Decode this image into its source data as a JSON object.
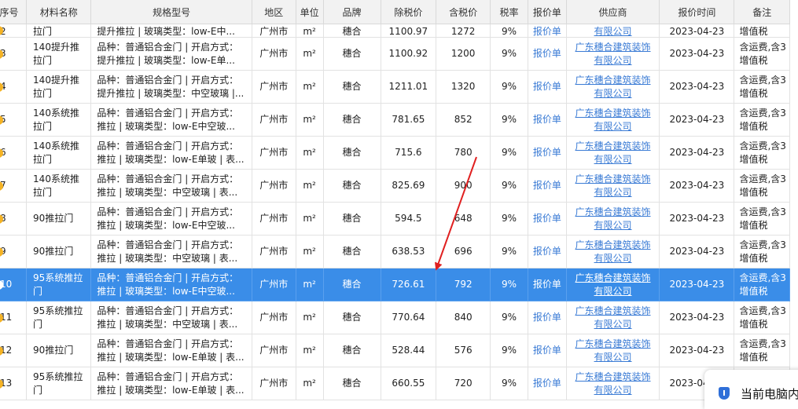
{
  "columns": [
    "序号",
    "材料名称",
    "规格型号",
    "地区",
    "单位",
    "品牌",
    "除税价",
    "含税价",
    "税率",
    "报价单",
    "供应商",
    "报价时间",
    "备注"
  ],
  "partial_row": {
    "index": "2",
    "name": "拉门",
    "spec": "提升推拉 | 玻璃类型：low-E中...",
    "region": "广州市",
    "unit": "m²",
    "brand": "穗合",
    "price_ex": "1100.97",
    "price_inc": "1272",
    "tax": "9%",
    "quote": "报价单",
    "supplier": "有限公司",
    "time": "2023-04-23",
    "remark": "增值税"
  },
  "rows": [
    {
      "index": "3",
      "name": [
        "140提升推",
        "拉门"
      ],
      "spec": [
        "品种：普通铝合金门 | 开启方式：",
        "提升推拉 | 玻璃类型：low-E单..."
      ],
      "region": "广州市",
      "unit": "m²",
      "brand": "穗合",
      "price_ex": "1100.92",
      "price_inc": "1200",
      "tax": "9%",
      "quote": "报价单",
      "supplier": [
        "广东穗合建筑装饰",
        "有限公司"
      ],
      "time": "2023-04-23",
      "remark": [
        "含运费,含3",
        "增值税"
      ]
    },
    {
      "index": "4",
      "name": [
        "140提升推",
        "拉门"
      ],
      "spec": [
        "品种：普通铝合金门 | 开启方式：",
        "提升推拉 | 玻璃类型：中空玻璃 |..."
      ],
      "region": "广州市",
      "unit": "m²",
      "brand": "穗合",
      "price_ex": "1211.01",
      "price_inc": "1320",
      "tax": "9%",
      "quote": "报价单",
      "supplier": [
        "广东穗合建筑装饰",
        "有限公司"
      ],
      "time": "2023-04-23",
      "remark": [
        "含运费,含3",
        "增值税"
      ]
    },
    {
      "index": "5",
      "name": [
        "140系统推",
        "拉门"
      ],
      "spec": [
        "品种：普通铝合金门 | 开启方式：",
        "推拉 | 玻璃类型：low-E中空玻..."
      ],
      "region": "广州市",
      "unit": "m²",
      "brand": "穗合",
      "price_ex": "781.65",
      "price_inc": "852",
      "tax": "9%",
      "quote": "报价单",
      "supplier": [
        "广东穗合建筑装饰",
        "有限公司"
      ],
      "time": "2023-04-23",
      "remark": [
        "含运费,含3",
        "增值税"
      ]
    },
    {
      "index": "6",
      "name": [
        "140系统推",
        "拉门"
      ],
      "spec": [
        "品种：普通铝合金门 | 开启方式：",
        "推拉 | 玻璃类型：low-E单玻 | 表..."
      ],
      "region": "广州市",
      "unit": "m²",
      "brand": "穗合",
      "price_ex": "715.6",
      "price_inc": "780",
      "tax": "9%",
      "quote": "报价单",
      "supplier": [
        "广东穗合建筑装饰",
        "有限公司"
      ],
      "time": "2023-04-23",
      "remark": [
        "含运费,含3",
        "增值税"
      ]
    },
    {
      "index": "7",
      "name": [
        "140系统推",
        "拉门"
      ],
      "spec": [
        "品种：普通铝合金门 | 开启方式：",
        "推拉 | 玻璃类型：中空玻璃 | 表..."
      ],
      "region": "广州市",
      "unit": "m²",
      "brand": "穗合",
      "price_ex": "825.69",
      "price_inc": "900",
      "tax": "9%",
      "quote": "报价单",
      "supplier": [
        "广东穗合建筑装饰",
        "有限公司"
      ],
      "time": "2023-04-23",
      "remark": [
        "含运费,含3",
        "增值税"
      ]
    },
    {
      "index": "8",
      "name": [
        "90推拉门"
      ],
      "spec": [
        "品种：普通铝合金门 | 开启方式：",
        "推拉 | 玻璃类型：low-E中空玻..."
      ],
      "region": "广州市",
      "unit": "m²",
      "brand": "穗合",
      "price_ex": "594.5",
      "price_inc": "648",
      "tax": "9%",
      "quote": "报价单",
      "supplier": [
        "广东穗合建筑装饰",
        "有限公司"
      ],
      "time": "2023-04-23",
      "remark": [
        "含运费,含3",
        "增值税"
      ]
    },
    {
      "index": "9",
      "name": [
        "90推拉门"
      ],
      "spec": [
        "品种：普通铝合金门 | 开启方式：",
        "推拉 | 玻璃类型：中空玻璃 | 表..."
      ],
      "region": "广州市",
      "unit": "m²",
      "brand": "穗合",
      "price_ex": "638.53",
      "price_inc": "696",
      "tax": "9%",
      "quote": "报价单",
      "supplier": [
        "广东穗合建筑装饰",
        "有限公司"
      ],
      "time": "2023-04-23",
      "remark": [
        "含运费,含3",
        "增值税"
      ]
    },
    {
      "index": "10",
      "selected": true,
      "name": [
        "95系统推拉",
        "门"
      ],
      "spec": [
        "品种：普通铝合金门 | 开启方式：",
        "推拉 | 玻璃类型：low-E中空玻..."
      ],
      "region": "广州市",
      "unit": "m²",
      "brand": "穗合",
      "price_ex": "726.61",
      "price_inc": "792",
      "tax": "9%",
      "quote": "报价单",
      "supplier": [
        "广东穗合建筑装饰",
        "有限公司"
      ],
      "time": "2023-04-23",
      "remark": [
        "含运费,含3",
        "增值税"
      ]
    },
    {
      "index": "11",
      "name": [
        "95系统推拉",
        "门"
      ],
      "spec": [
        "品种：普通铝合金门 | 开启方式：",
        "推拉 | 玻璃类型：中空玻璃 | 表..."
      ],
      "region": "广州市",
      "unit": "m²",
      "brand": "穗合",
      "price_ex": "770.64",
      "price_inc": "840",
      "tax": "9%",
      "quote": "报价单",
      "supplier": [
        "广东穗合建筑装饰",
        "有限公司"
      ],
      "time": "2023-04-23",
      "remark": [
        "含运费,含3",
        "增值税"
      ]
    },
    {
      "index": "12",
      "name": [
        "90推拉门"
      ],
      "spec": [
        "品种：普通铝合金门 | 开启方式：",
        "推拉 | 玻璃类型：low-E单玻 | 表..."
      ],
      "region": "广州市",
      "unit": "m²",
      "brand": "穗合",
      "price_ex": "528.44",
      "price_inc": "576",
      "tax": "9%",
      "quote": "报价单",
      "supplier": [
        "广东穗合建筑装饰",
        "有限公司"
      ],
      "time": "2023-04-23",
      "remark": [
        "含运费,含3",
        "增值税"
      ]
    },
    {
      "index": "13",
      "name": [
        "95系统推拉",
        "门"
      ],
      "spec": [
        "品种：普通铝合金门 | 开启方式：",
        "推拉 | 玻璃类型：low-E单玻 | 表..."
      ],
      "region": "广州市",
      "unit": "m²",
      "brand": "穗合",
      "price_ex": "660.55",
      "price_inc": "720",
      "tax": "9%",
      "quote": "报价单",
      "supplier": [
        "广东穗合建筑装饰",
        "有限公司"
      ],
      "time": "2023-04-23",
      "remark": [
        "含运费,含3",
        "增值税"
      ]
    }
  ],
  "notice": {
    "text": "当前电脑内",
    "icon": "shield-icon"
  },
  "colors": {
    "selected_row": "#3a8de8",
    "link": "#3a7bd5",
    "marker": "#f5b324",
    "annotation_arrow": "#e02020"
  }
}
